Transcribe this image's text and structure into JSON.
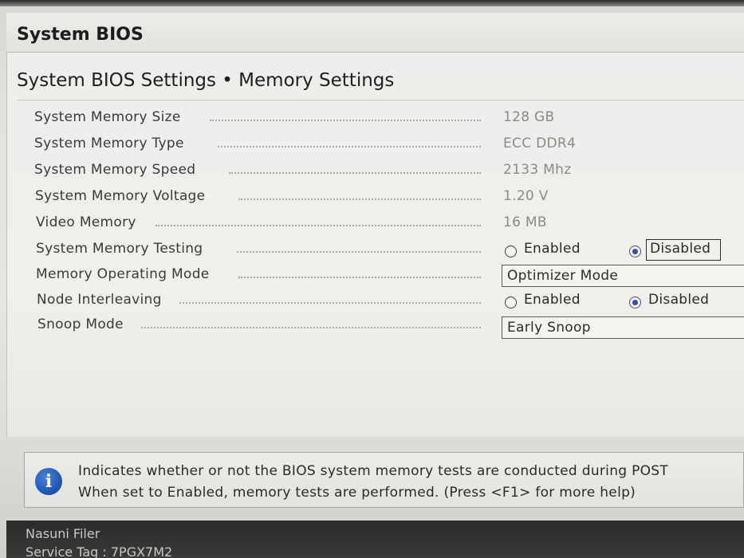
{
  "app": {
    "title": "System BIOS"
  },
  "page": {
    "title": "System BIOS Settings • Memory Settings"
  },
  "settings": [
    {
      "label": "System Memory Size",
      "value": "128 GB"
    },
    {
      "label": "System Memory Type",
      "value": "ECC DDR4"
    },
    {
      "label": "System Memory Speed",
      "value": "2133 Mhz"
    },
    {
      "label": "System Memory Voltage",
      "value": "1.20 V"
    },
    {
      "label": "Video Memory",
      "value": "16 MB"
    },
    {
      "label": "System Memory Testing",
      "options": [
        "Enabled",
        "Disabled"
      ],
      "selected": "Disabled"
    },
    {
      "label": "Memory Operating Mode",
      "value": "Optimizer Mode"
    },
    {
      "label": "Node Interleaving",
      "options": [
        "Enabled",
        "Disabled"
      ],
      "selected": "Disabled"
    },
    {
      "label": "Snoop Mode",
      "value": "Early Snoop"
    }
  ],
  "help": {
    "icon": "info-icon",
    "line1": "Indicates whether or not the BIOS system memory tests are conducted during POST",
    "line2": "When set to Enabled, memory tests are performed. (Press <F1> for more help)"
  },
  "footer": {
    "line1": "Nasuni Filer",
    "line2": "Service Tag : 7PGX7M2"
  },
  "colors": {
    "info_blue": "#1f58b8",
    "radio_selected": "#3a4fa8",
    "footer_bg": "#2b2b2b"
  }
}
